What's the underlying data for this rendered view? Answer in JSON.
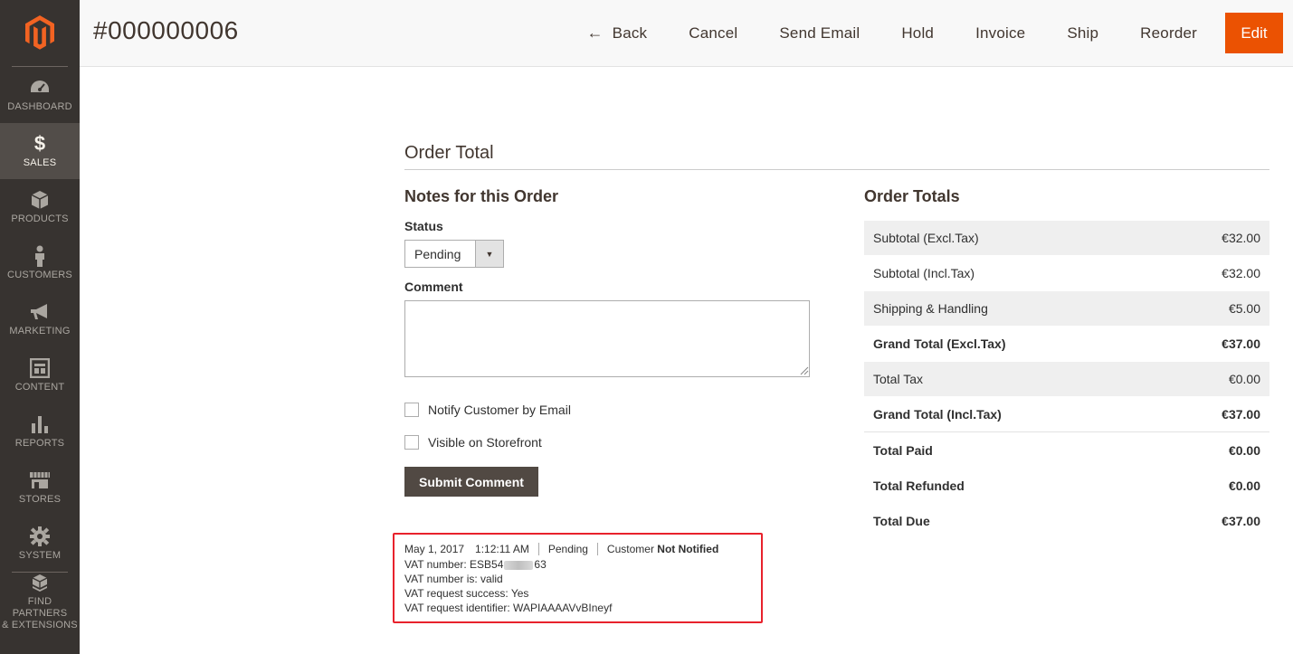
{
  "sidebar": {
    "items": [
      {
        "label": "DASHBOARD",
        "icon": "dashboard-icon",
        "active": false
      },
      {
        "label": "SALES",
        "icon": "dollar-icon",
        "active": true
      },
      {
        "label": "PRODUCTS",
        "icon": "box-icon",
        "active": false
      },
      {
        "label": "CUSTOMERS",
        "icon": "person-icon",
        "active": false
      },
      {
        "label": "MARKETING",
        "icon": "megaphone-icon",
        "active": false
      },
      {
        "label": "CONTENT",
        "icon": "layout-icon",
        "active": false
      },
      {
        "label": "REPORTS",
        "icon": "bar-chart-icon",
        "active": false
      },
      {
        "label": "STORES",
        "icon": "storefront-icon",
        "active": false
      },
      {
        "label": "SYSTEM",
        "icon": "gear-icon",
        "active": false
      }
    ],
    "partners": {
      "line1": "FIND PARTNERS",
      "line2": "& EXTENSIONS",
      "icon": "blocks-icon"
    }
  },
  "header": {
    "title": "#000000006",
    "actions": {
      "back": "Back",
      "cancel": "Cancel",
      "send_email": "Send Email",
      "hold": "Hold",
      "invoice": "Invoice",
      "ship": "Ship",
      "reorder": "Reorder",
      "edit": "Edit"
    }
  },
  "main": {
    "section_title": "Order Total",
    "notes": {
      "title": "Notes for this Order",
      "status_label": "Status",
      "status_value": "Pending",
      "comment_label": "Comment",
      "comment_value": "",
      "notify_label": "Notify Customer by Email",
      "visible_label": "Visible on Storefront",
      "submit_label": "Submit Comment"
    },
    "history": {
      "date": "May 1, 2017",
      "time": "1:12:11 AM",
      "status": "Pending",
      "customer_prefix": "Customer",
      "customer_state": "Not Notified",
      "vat_number_prefix": "VAT number: ESB54",
      "vat_number_suffix": "63",
      "vat_valid": "VAT number is: valid",
      "vat_success": "VAT request success: Yes",
      "vat_identifier": "VAT request identifier: WAPIAAAAVvBIneyf"
    },
    "totals": {
      "title": "Order Totals",
      "rows": [
        {
          "label": "Subtotal (Excl.Tax)",
          "value": "€32.00"
        },
        {
          "label": "Subtotal (Incl.Tax)",
          "value": "€32.00"
        },
        {
          "label": "Shipping & Handling",
          "value": "€5.00"
        },
        {
          "label": "Grand Total (Excl.Tax)",
          "value": "€37.00"
        },
        {
          "label": "Total Tax",
          "value": "€0.00"
        },
        {
          "label": "Grand Total (Incl.Tax)",
          "value": "€37.00"
        },
        {
          "label": "Total Paid",
          "value": "€0.00"
        },
        {
          "label": "Total Refunded",
          "value": "€0.00"
        },
        {
          "label": "Total Due",
          "value": "€37.00"
        }
      ]
    }
  },
  "colors": {
    "sidebar_bg": "#373330",
    "sidebar_active": "#524d49",
    "accent_orange": "#eb5202",
    "logo_orange": "#f26322",
    "button_dark": "#514943",
    "highlight_red": "#e8222c"
  }
}
